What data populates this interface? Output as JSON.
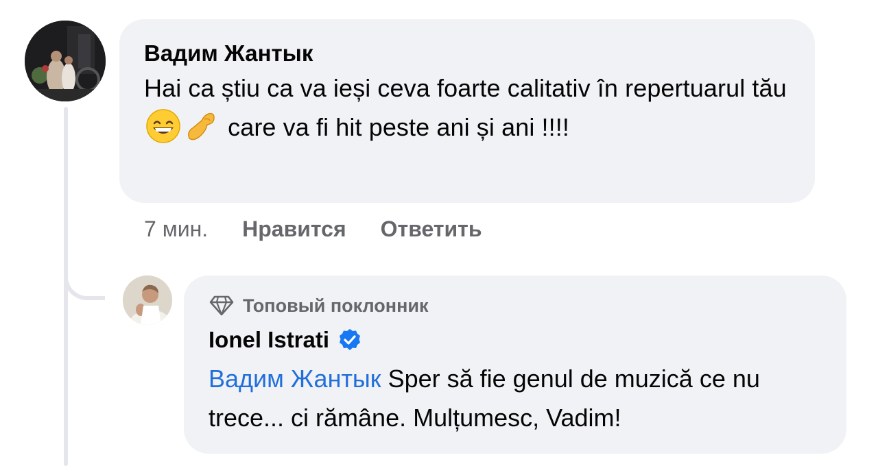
{
  "comment": {
    "author": "Вадим Жантык",
    "text_part1": "Hai ca știu ca va ieși ceva foarte calitativ în repertuarul tău",
    "emoji_1": "grinning-face-emoji",
    "emoji_2": "pinching-hand-emoji",
    "text_part2": "care va fi hit peste ani și ani !!!!",
    "time": "7 мин.",
    "like_label": "Нравится",
    "reply_label": "Ответить"
  },
  "reply": {
    "badge_icon": "diamond-icon",
    "badge_label": "Топовый поклонник",
    "author": "Ionel Istrati",
    "verified_icon": "verified-badge-icon",
    "mention": "Вадим Жантык",
    "text": "Sper să fie genul de muzică ce nu trece... ci rămâne. Mulțumesc, Vadim!"
  },
  "colors": {
    "bubble_bg": "#f0f2f5",
    "meta_text": "#65676b",
    "mention": "#216fdb",
    "verified": "#1877f2",
    "thread_line": "#e4e6eb"
  }
}
